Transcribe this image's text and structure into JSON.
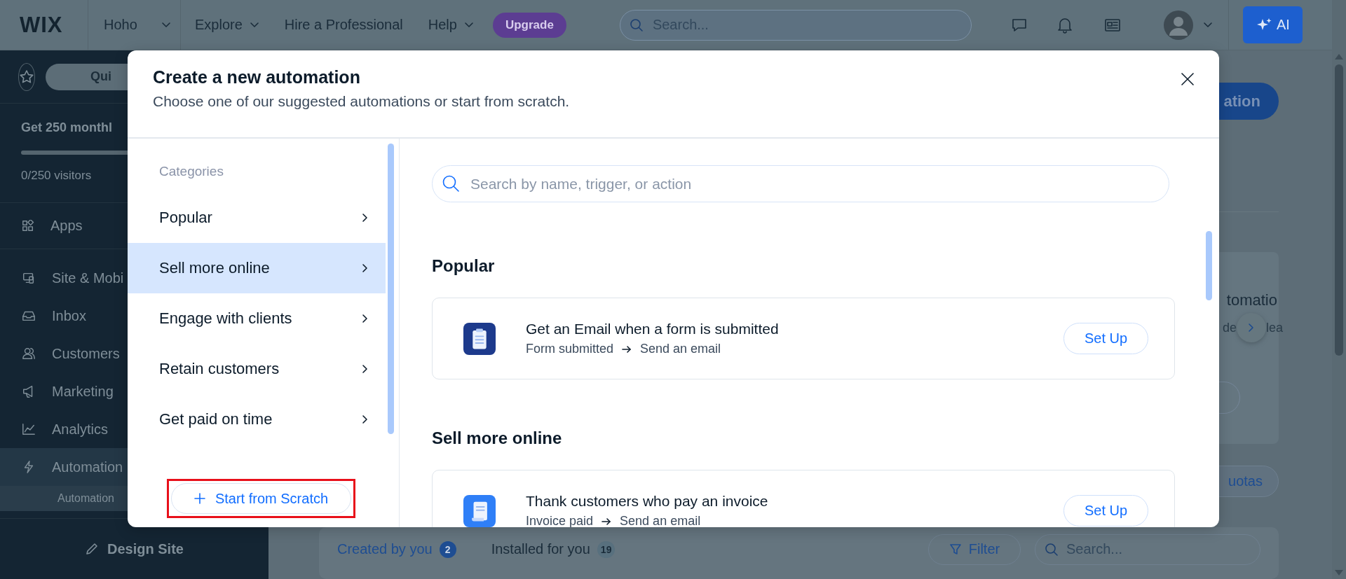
{
  "top_bar": {
    "logo": "WIX",
    "site_menu": "Hoho",
    "nav": [
      {
        "label": "Explore",
        "kind": "dropdown"
      },
      {
        "label": "Hire a Professional",
        "kind": "link"
      },
      {
        "label": "Help",
        "kind": "dropdown"
      }
    ],
    "upgrade": "Upgrade",
    "search": {
      "placeholder": "Search..."
    },
    "ai_button": "AI"
  },
  "sidebar": {
    "quick_access": "Qui",
    "promo": {
      "title": "Get 250 monthl",
      "level": 0,
      "count": "0/250 visitors"
    },
    "apps": "Apps",
    "items": [
      {
        "label": "Site & Mobi",
        "selected": false
      },
      {
        "label": "Inbox",
        "selected": false
      },
      {
        "label": "Customers",
        "selected": false
      },
      {
        "label": "Marketing",
        "selected": false
      },
      {
        "label": "Analytics",
        "selected": false
      },
      {
        "label": "Automation",
        "selected": true,
        "children": [
          {
            "label": "Automation",
            "selected": true
          }
        ]
      }
    ],
    "design_button": "Design Site"
  },
  "main": {
    "primary_button": "ation",
    "card": {
      "title": "tomatio",
      "text_parts": [
        "de",
        "lea"
      ]
    },
    "quotas_button": "uotas",
    "tabs": [
      {
        "label": "Created by you",
        "count": "2",
        "selected": true
      },
      {
        "label": "Installed for you",
        "count": "19",
        "selected": false
      }
    ],
    "filter_button": "Filter",
    "search": {
      "placeholder": "Search..."
    }
  },
  "modal": {
    "title": "Create a new automation",
    "subtitle": "Choose one of our suggested automations or start from scratch.",
    "categories_label": "Categories",
    "categories": [
      {
        "label": "Popular",
        "selected": false
      },
      {
        "label": "Sell more online",
        "selected": true
      },
      {
        "label": "Engage with clients",
        "selected": false
      },
      {
        "label": "Retain customers",
        "selected": false
      },
      {
        "label": "Get paid on time",
        "selected": false
      }
    ],
    "start_button": {
      "label": "Start from Scratch",
      "highlighted": true
    },
    "search": {
      "placeholder": "Search by name, trigger, or action"
    },
    "sections": [
      {
        "heading": "Popular",
        "templates": [
          {
            "kind": "form",
            "color": "#1d3a8c",
            "title": "Get an Email when a form is submitted",
            "trigger": "Form submitted",
            "action": "Send an email",
            "button": "Set Up"
          }
        ]
      },
      {
        "heading": "Sell more online",
        "templates": [
          {
            "kind": "invoice",
            "color": "#2f7ff7",
            "title": "Thank customers who pay an invoice",
            "trigger": "Invoice paid",
            "action": "Send an email",
            "button": "Set Up"
          }
        ]
      }
    ]
  }
}
